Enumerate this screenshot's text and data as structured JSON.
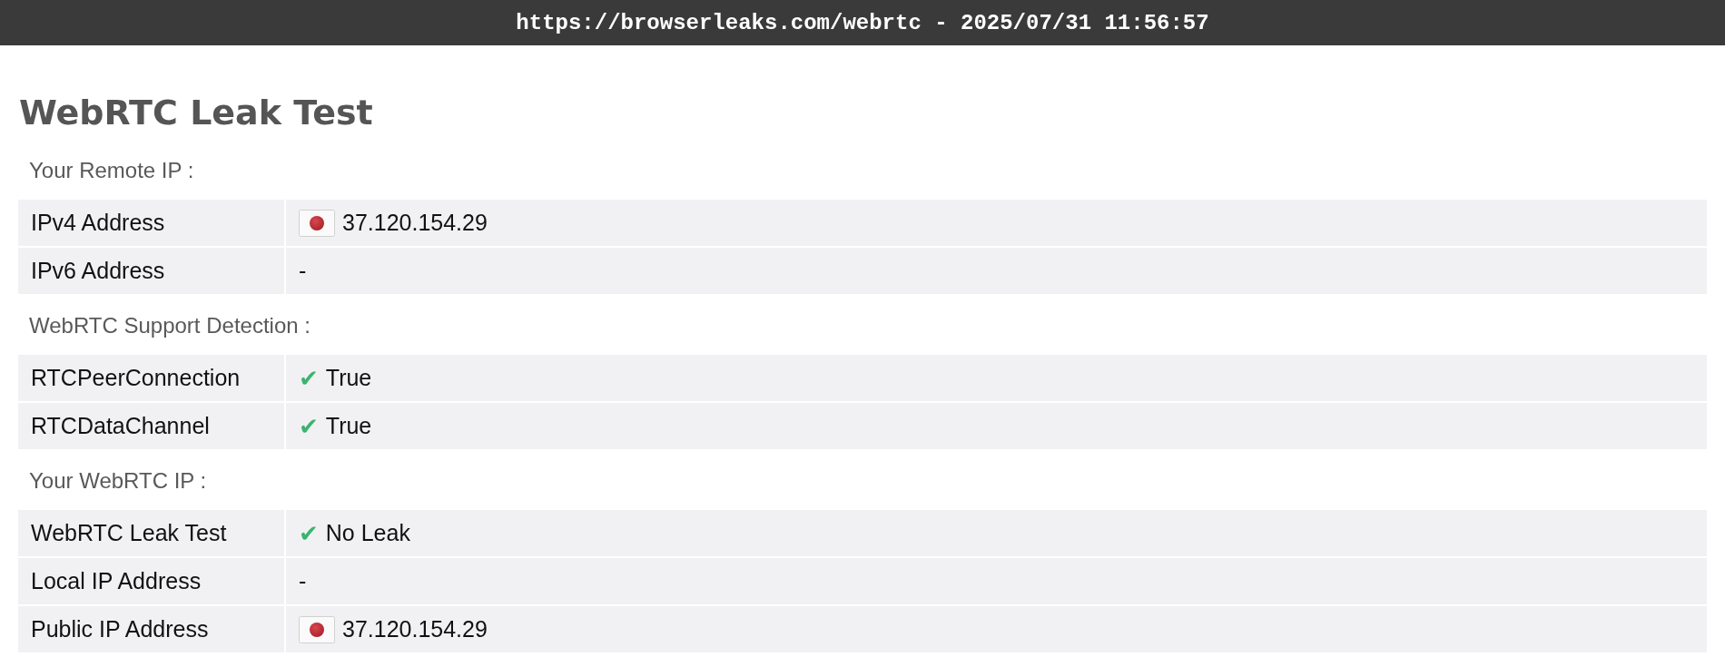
{
  "address_bar": {
    "text": "https://browserleaks.com/webrtc - 2025/07/31 11:56:57"
  },
  "page": {
    "title": "WebRTC Leak Test"
  },
  "sections": [
    {
      "heading": "Your Remote IP :",
      "rows": [
        {
          "label": "IPv4 Address",
          "kind": "flag",
          "value": "37.120.154.29"
        },
        {
          "label": "IPv6 Address",
          "kind": "plain",
          "value": "-"
        }
      ]
    },
    {
      "heading": "WebRTC Support Detection :",
      "rows": [
        {
          "label": "RTCPeerConnection",
          "kind": "check",
          "mark": "✔",
          "value": "True"
        },
        {
          "label": "RTCDataChannel",
          "kind": "check",
          "mark": "✔",
          "value": "True"
        }
      ]
    },
    {
      "heading": "Your WebRTC IP :",
      "rows": [
        {
          "label": "WebRTC Leak Test",
          "kind": "check",
          "mark": "✔",
          "value": "No Leak"
        },
        {
          "label": "Local IP Address",
          "kind": "plain",
          "value": "-"
        },
        {
          "label": "Public IP Address",
          "kind": "flag",
          "value": "37.120.154.29"
        }
      ]
    }
  ]
}
